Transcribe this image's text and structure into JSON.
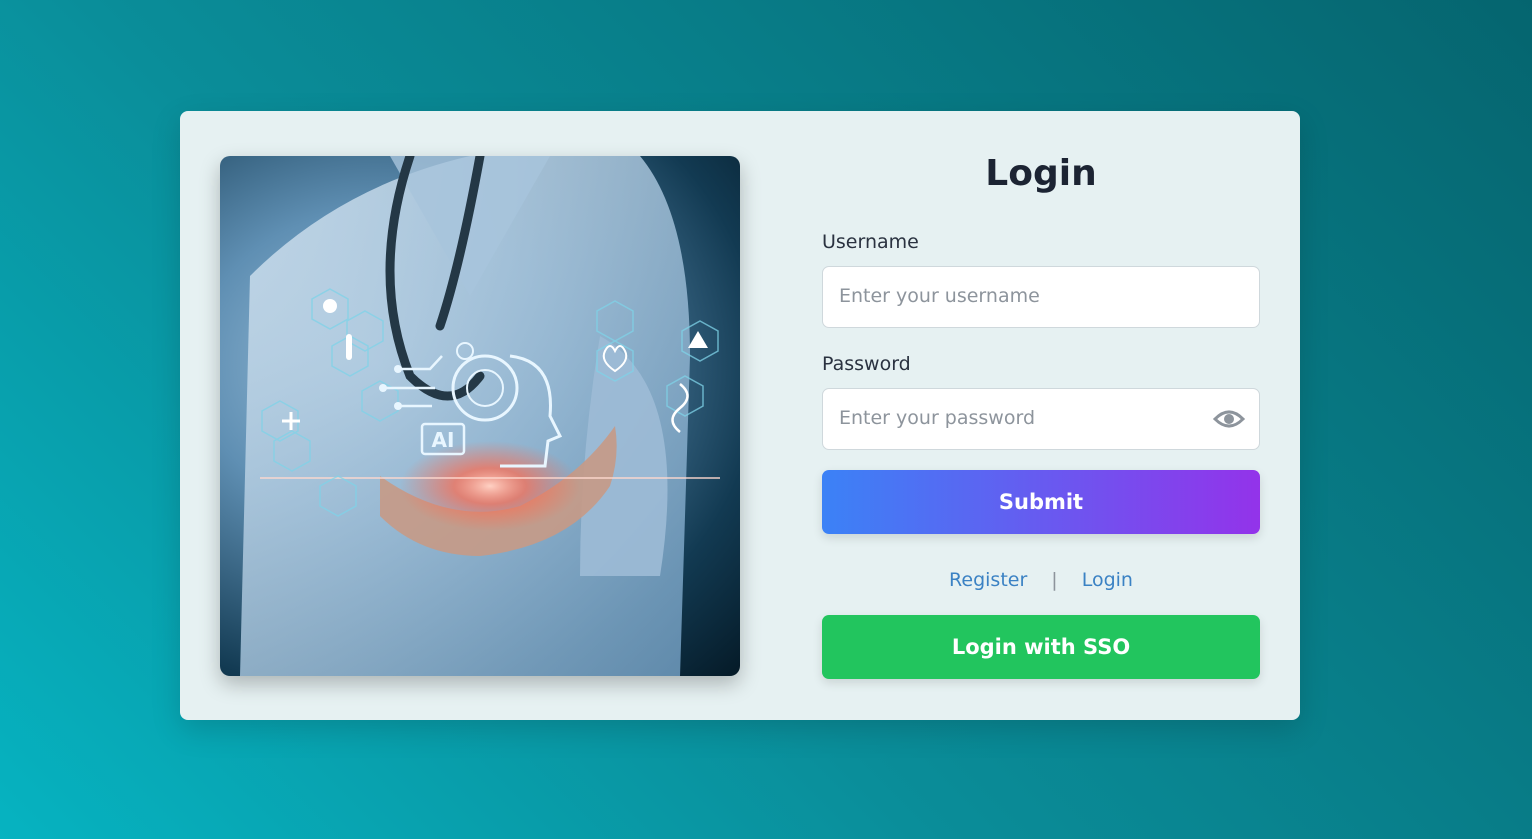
{
  "form": {
    "title": "Login",
    "username_label": "Username",
    "username_placeholder": "Enter your username",
    "password_label": "Password",
    "password_placeholder": "Enter your password",
    "submit_label": "Submit",
    "register_link": "Register",
    "separator": "|",
    "login_link": "Login",
    "sso_label": "Login with SSO"
  },
  "hero": {
    "ai_badge": "AI"
  },
  "colors": {
    "submit_gradient_start": "#3b82f6",
    "submit_gradient_end": "#9333ea",
    "sso_green": "#22c55e",
    "link_blue": "#3b82c4"
  },
  "icons": {
    "password_toggle": "eye-icon"
  }
}
